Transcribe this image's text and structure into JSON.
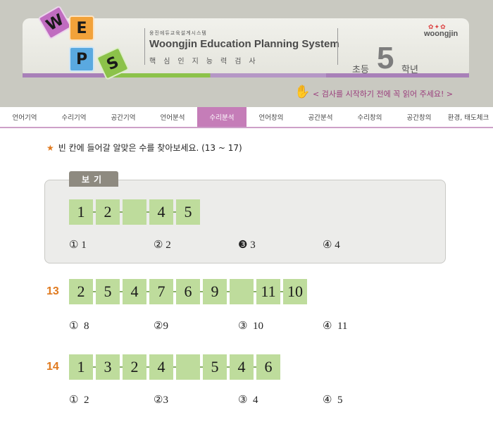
{
  "header": {
    "logo_letters": [
      "W",
      "E",
      "P",
      "S"
    ],
    "system_small": "웅진에듀교육설계시스템",
    "system_name": "Woongjin Education Planning System",
    "system_sub": "핵심인지능력검사",
    "grade_prefix": "초등",
    "grade_number": "5",
    "grade_suffix": "학년",
    "brand": "woongjin",
    "notice": "< 검사를 시작하기 전에 꼭 읽어 주세요! >"
  },
  "nav": {
    "tabs": [
      "언어기억",
      "수리기억",
      "공간기억",
      "언어분석",
      "수리분석",
      "언어창의",
      "공간분석",
      "수리창의",
      "공간창의",
      "환경, 태도체크"
    ],
    "active_index": 4
  },
  "content": {
    "instruction": "빈 칸에 들어갈 알맞은 수를 찾아보세요. (13 ~ 17)",
    "example": {
      "label": "보기",
      "sequence": [
        "1",
        "2",
        "",
        "4",
        "5"
      ],
      "options": [
        "① 1",
        "② 2",
        "❸ 3",
        "④ 4"
      ]
    },
    "questions": [
      {
        "number": "13",
        "sequence": [
          "2",
          "5",
          "4",
          "7",
          "6",
          "9",
          "",
          "11",
          "10"
        ],
        "options": [
          "①  8",
          "②9",
          "③  10",
          "④  11"
        ]
      },
      {
        "number": "14",
        "sequence": [
          "1",
          "3",
          "2",
          "4",
          "",
          "5",
          "4",
          "6"
        ],
        "options": [
          "①  2",
          "②3",
          "③  4",
          "④  5"
        ]
      }
    ]
  },
  "colors": {
    "header_bg": "#c9c9c1",
    "accent_purple": "#c57db8",
    "accent_orange": "#e07a1f",
    "cell_green": "#bedc9c",
    "notice": "#9a3d7c"
  },
  "icons": {
    "instruction_star": "star-icon",
    "notice_hand": "pointing-hand-icon"
  }
}
